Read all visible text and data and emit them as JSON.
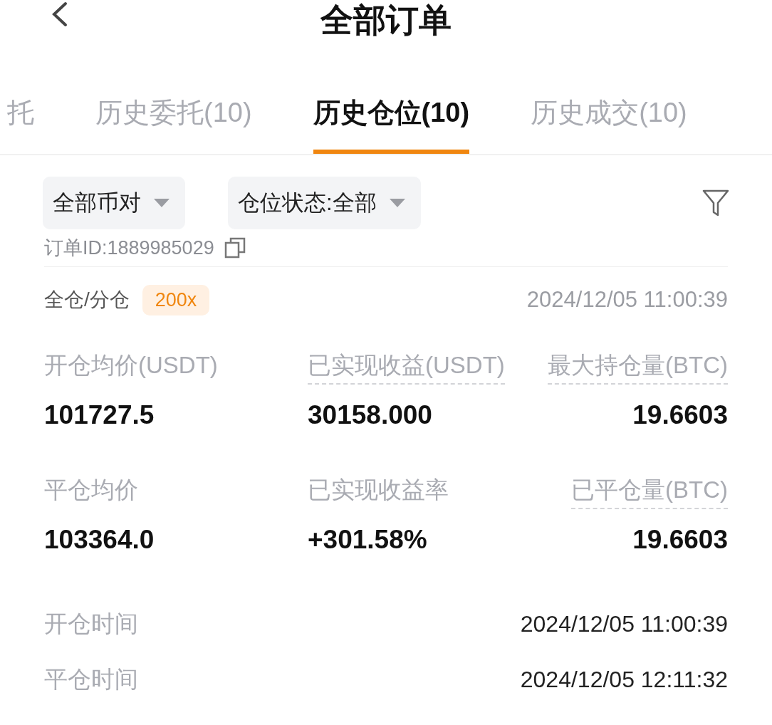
{
  "header": {
    "title": "全部订单"
  },
  "tabs": [
    {
      "label": "托",
      "selected": false
    },
    {
      "label": "历史委托(10)",
      "selected": false
    },
    {
      "label": "历史仓位(10)",
      "selected": true
    },
    {
      "label": "历史成交(10)",
      "selected": false
    }
  ],
  "filters": [
    {
      "label": "全部币对"
    },
    {
      "label": "仓位状态:全部"
    }
  ],
  "order": {
    "id_label": "订单ID:1889985029",
    "margin_mode": "全仓/分仓",
    "leverage": "200x",
    "time": "2024/12/05 11:00:39",
    "stats": [
      {
        "label": "开仓均价(USDT)",
        "value": "101727.5",
        "dashed": false
      },
      {
        "label": "已实现收益(USDT)",
        "value": "30158.000",
        "dashed": true
      },
      {
        "label": "最大持仓量(BTC)",
        "value": "19.6603",
        "dashed": true
      },
      {
        "label": "平仓均价",
        "value": "103364.0",
        "dashed": false
      },
      {
        "label": "已实现收益率",
        "value": "+301.58%",
        "dashed": false
      },
      {
        "label": "已平仓量(BTC)",
        "value": "19.6603",
        "dashed": true
      }
    ],
    "times": [
      {
        "label": "开仓时间",
        "value": "2024/12/05 11:00:39"
      },
      {
        "label": "平仓时间",
        "value": "2024/12/05 12:11:32"
      }
    ]
  }
}
